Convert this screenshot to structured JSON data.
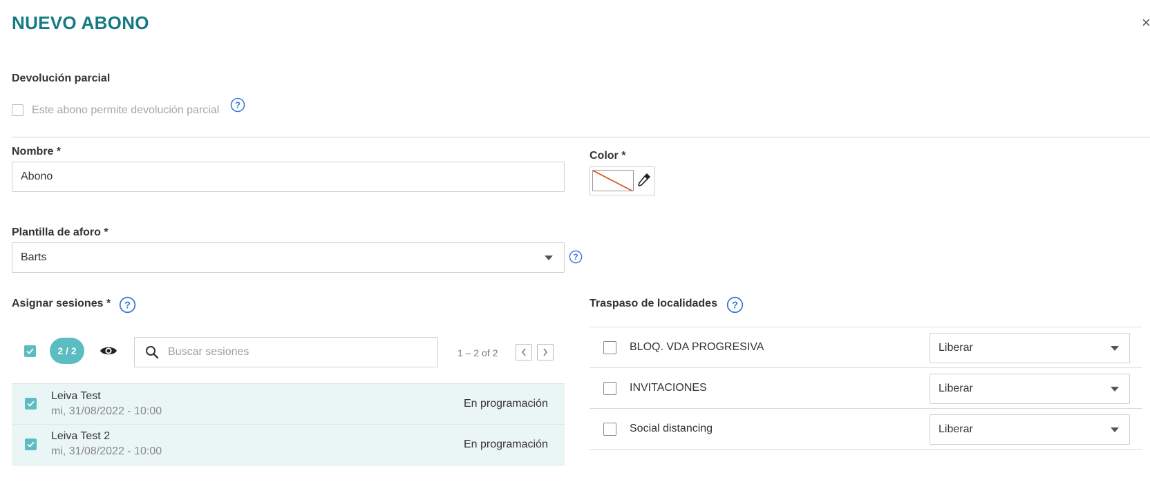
{
  "dialog": {
    "title": "NUEVO ABONO",
    "close_label": "×"
  },
  "partial_refund": {
    "heading": "Devolución parcial",
    "checkbox_label": "Este abono permite devolución parcial",
    "checked": false
  },
  "name_field": {
    "label": "Nombre *",
    "value": "Abono"
  },
  "color_field": {
    "label": "Color *",
    "value": "none"
  },
  "capacity_template": {
    "label": "Plantilla de aforo *",
    "selected": "Barts"
  },
  "sessions": {
    "heading": "Asignar sesiones *",
    "selected_count": "2 / 2",
    "search_placeholder": "Buscar sesiones",
    "pagination": "1 – 2 of 2",
    "rows": [
      {
        "title": "Leiva Test",
        "date": "mi, 31/08/2022 - 10:00",
        "status": "En programación",
        "checked": true
      },
      {
        "title": "Leiva Test 2",
        "date": "mi, 31/08/2022 - 10:00",
        "status": "En programación",
        "checked": true
      }
    ]
  },
  "transfer": {
    "heading": "Traspaso de localidades",
    "rows": [
      {
        "label": "BLOQ. VDA PROGRESIVA",
        "option": "Liberar",
        "checked": false
      },
      {
        "label": "INVITACIONES",
        "option": "Liberar",
        "checked": false
      },
      {
        "label": "Social distancing",
        "option": "Liberar",
        "checked": false
      }
    ]
  },
  "colors": {
    "accent": "#137a82",
    "teal": "#5bbcc2",
    "help_icon": "#3a7bd5",
    "row_highlight": "#eaf5f6"
  }
}
